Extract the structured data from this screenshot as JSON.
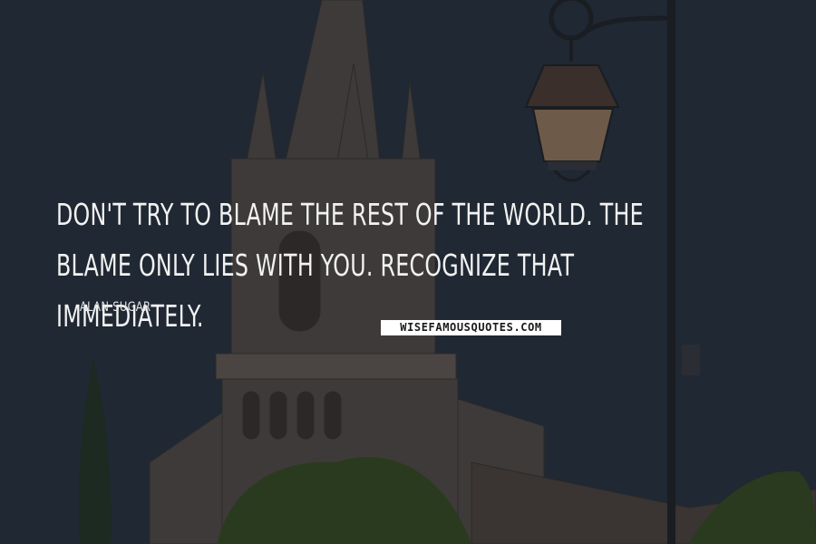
{
  "quote": {
    "text": "DON'T TRY TO BLAME THE REST OF THE WORLD. THE BLAME ONLY LIES WITH YOU. RECOGNIZE THAT IMMEDIATELY.",
    "author": "ALAN SUGAR"
  },
  "watermark": {
    "text": "WISEFAMOUSQUOTES.COM"
  },
  "colors": {
    "overlay": "#1f2833",
    "text": "#f2f2f2",
    "watermark_bg": "#ffffff"
  }
}
